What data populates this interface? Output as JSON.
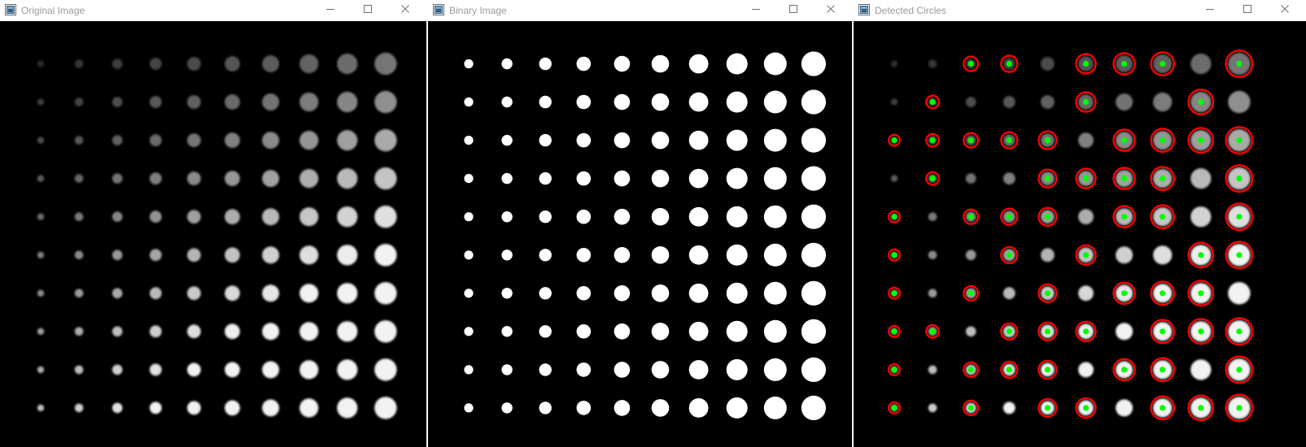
{
  "windows": [
    {
      "title": "Original Image",
      "mode": "original"
    },
    {
      "title": "Binary Image",
      "mode": "binary"
    },
    {
      "title": "Detected Circles",
      "mode": "detected"
    }
  ],
  "controls": {
    "minimize_icon": "minimize-icon",
    "maximize_icon": "maximize-icon",
    "close_icon": "close-icon"
  },
  "grid": {
    "rows": 10,
    "columns": 10
  },
  "detected_circles": [
    [
      0,
      2
    ],
    [
      0,
      3
    ],
    [
      0,
      5
    ],
    [
      0,
      6
    ],
    [
      0,
      7
    ],
    [
      0,
      9
    ],
    [
      1,
      1
    ],
    [
      1,
      5
    ],
    [
      1,
      8
    ],
    [
      2,
      0
    ],
    [
      2,
      1
    ],
    [
      2,
      2
    ],
    [
      2,
      3
    ],
    [
      2,
      4
    ],
    [
      2,
      6
    ],
    [
      2,
      7
    ],
    [
      2,
      8
    ],
    [
      2,
      9
    ],
    [
      3,
      1
    ],
    [
      3,
      4
    ],
    [
      3,
      5
    ],
    [
      3,
      6
    ],
    [
      3,
      7
    ],
    [
      3,
      9
    ],
    [
      4,
      0
    ],
    [
      4,
      2
    ],
    [
      4,
      3
    ],
    [
      4,
      4
    ],
    [
      4,
      6
    ],
    [
      4,
      7
    ],
    [
      4,
      9
    ],
    [
      5,
      0
    ],
    [
      5,
      3
    ],
    [
      5,
      5
    ],
    [
      5,
      8
    ],
    [
      5,
      9
    ],
    [
      6,
      0
    ],
    [
      6,
      2
    ],
    [
      6,
      4
    ],
    [
      6,
      6
    ],
    [
      6,
      7
    ],
    [
      6,
      8
    ],
    [
      7,
      0
    ],
    [
      7,
      1
    ],
    [
      7,
      3
    ],
    [
      7,
      4
    ],
    [
      7,
      5
    ],
    [
      7,
      7
    ],
    [
      7,
      8
    ],
    [
      7,
      9
    ],
    [
      8,
      0
    ],
    [
      8,
      2
    ],
    [
      8,
      3
    ],
    [
      8,
      4
    ],
    [
      8,
      6
    ],
    [
      8,
      7
    ],
    [
      8,
      9
    ],
    [
      9,
      0
    ],
    [
      9,
      2
    ],
    [
      9,
      4
    ],
    [
      9,
      5
    ],
    [
      9,
      7
    ],
    [
      9,
      8
    ],
    [
      9,
      9
    ]
  ],
  "colors": {
    "canvas": "#000000",
    "circle_outline": "#ff0000",
    "center_marker": "#00ff00",
    "binary_dot": "#ffffff"
  }
}
